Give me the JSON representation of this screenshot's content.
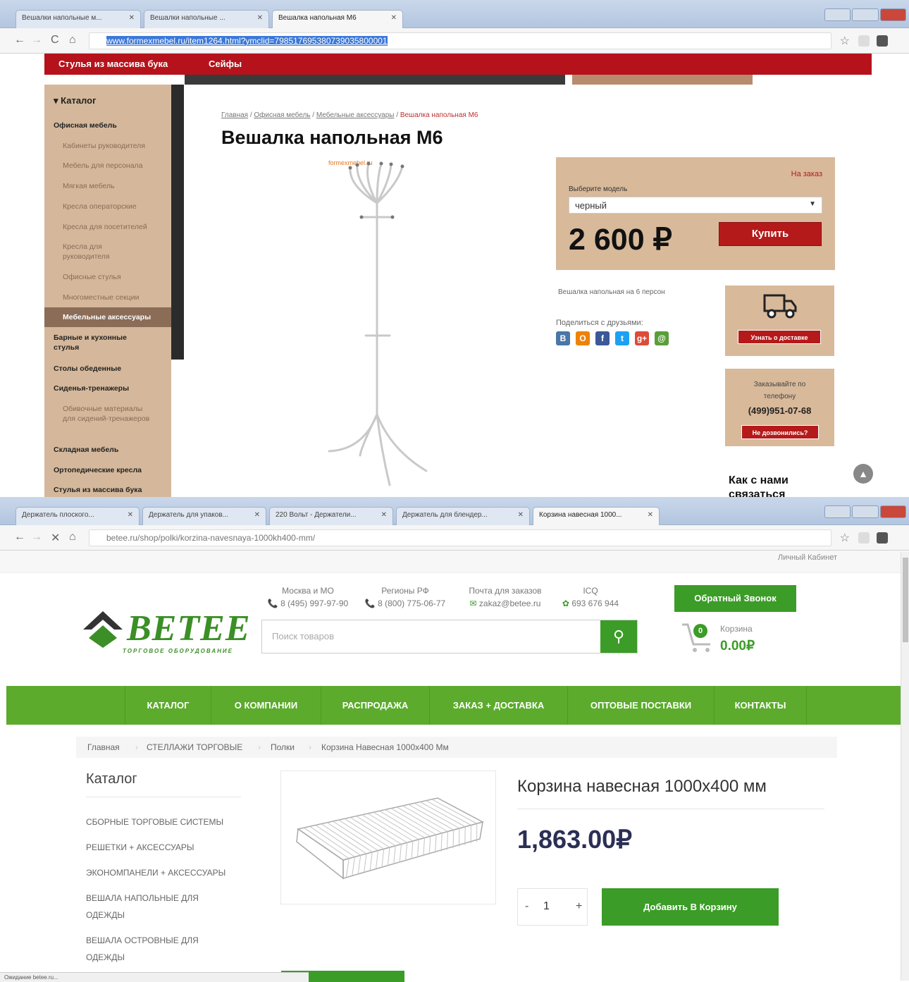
{
  "window1": {
    "tabs": [
      {
        "label": "Вешалки напольные м..."
      },
      {
        "label": "Вешалки напольные ..."
      },
      {
        "label": "Вешалка напольная М6"
      }
    ],
    "url": "www.formexmebel.ru/item1264.html?ymclid=798517695380739035800001",
    "site": {
      "top_menu": [
        "Стулья из массива бука",
        "Сейфы"
      ],
      "catalog_title": "▾ Каталог",
      "sidebar": [
        {
          "label": "Офисная мебель",
          "kind": "top"
        },
        {
          "label": "Кабинеты руководителя",
          "kind": "sub"
        },
        {
          "label": "Мебель для персонала",
          "kind": "sub"
        },
        {
          "label": "Мягкая мебель",
          "kind": "sub"
        },
        {
          "label": "Кресла операторские",
          "kind": "sub"
        },
        {
          "label": "Кресла для посетителей",
          "kind": "sub"
        },
        {
          "label": "Кресла для руководителя",
          "kind": "sub"
        },
        {
          "label": "Офисные стулья",
          "kind": "sub"
        },
        {
          "label": "Многоместные секции",
          "kind": "sub"
        },
        {
          "label": "Мебельные аксессуары",
          "kind": "active"
        },
        {
          "label": "Барные и кухонные стулья",
          "kind": "top"
        },
        {
          "label": "Столы обеденные",
          "kind": "top"
        },
        {
          "label": "Сиденья-тренажеры",
          "kind": "top"
        },
        {
          "label": "Обивочные материалы для сидений-тренажеров",
          "kind": "sub"
        },
        {
          "label": "Складная мебель",
          "kind": "top"
        },
        {
          "label": "Ортопедические кресла",
          "kind": "top"
        },
        {
          "label": "Стулья из массива бука",
          "kind": "top"
        }
      ],
      "breadcrumb": {
        "home": "Главная",
        "c1": "Офисная мебель",
        "c2": "Мебельные аксессуары",
        "current": "Вешалка напольная М6"
      },
      "title": "Вешалка напольная М6",
      "image_brand": "formexmebel.ru",
      "availability": "На заказ",
      "model_label": "Выберите модель",
      "model_value": "черный",
      "price": "2 600 ₽",
      "buy_label": "Купить",
      "description": "Вешалка напольная на 6 персон",
      "share_label": "Поделиться с друзьями:",
      "social": [
        {
          "glyph": "В",
          "color": "#4a76a8"
        },
        {
          "glyph": "О",
          "color": "#ee8208"
        },
        {
          "glyph": "f",
          "color": "#3b5998"
        },
        {
          "glyph": "t",
          "color": "#1da1f2"
        },
        {
          "glyph": "g+",
          "color": "#dd4b39"
        },
        {
          "glyph": "@",
          "color": "#5a9e3a"
        }
      ],
      "delivery_btn": "Узнать о доставке",
      "phone_text": "Заказывайте по телефону",
      "phone": "(499)951-07-68",
      "callback": "Не дозвонились?",
      "contact_title": "Как с нами связаться"
    }
  },
  "window2": {
    "tabs": [
      {
        "label": "Держатель плоского..."
      },
      {
        "label": "Держатель для упаков..."
      },
      {
        "label": "220 Вольт - Держатели..."
      },
      {
        "label": "Держатель для блендер..."
      },
      {
        "label": "Корзина навесная 1000..."
      }
    ],
    "url": "betee.ru/shop/polki/korzina-navesnaya-1000kh400-mm/",
    "site": {
      "account": "Личный Кабинет",
      "logo": "BETEE",
      "logo_sub": "ТОРГОВОЕ ОБОРУДОВАНИЕ",
      "contacts": [
        {
          "label": "Москва и МО",
          "value": "8 (495) 997-97-90",
          "icon": "phone-icon"
        },
        {
          "label": "Регионы РФ",
          "value": "8 (800) 775-06-77",
          "icon": "phone-icon"
        },
        {
          "label": "Почта для заказов",
          "value": "zakaz@betee.ru",
          "icon": "mail-icon"
        },
        {
          "label": "ICQ",
          "value": "693 676 944",
          "icon": "icq-icon"
        }
      ],
      "search_placeholder": "Поиск товаров",
      "callback_btn": "Обратный Звонок",
      "cart_count": "0",
      "cart_label": "Корзина",
      "cart_total": "0.00₽",
      "nav": [
        "КАТАЛОГ",
        "О КОМПАНИИ",
        "РАСПРОДАЖА",
        "ЗАКАЗ + ДОСТАВКА",
        "ОПТОВЫЕ ПОСТАВКИ",
        "КОНТАКТЫ"
      ],
      "breadcrumb": [
        "Главная",
        "СТЕЛЛАЖИ ТОРГОВЫЕ",
        "Полки",
        "Корзина Навесная 1000х400 Мм"
      ],
      "catalog_title": "Каталог",
      "catalog": [
        "СБОРНЫЕ ТОРГОВЫЕ СИСТЕМЫ",
        "РЕШЕТКИ + АКСЕССУАРЫ",
        "ЭКОНОМПАНЕЛИ + АКСЕССУАРЫ",
        "ВЕШАЛА НАПОЛЬНЫЕ ДЛЯ ОДЕЖДЫ",
        "ВЕШАЛА ОСТРОВНЫЕ ДЛЯ ОДЕЖДЫ"
      ],
      "product_title": "Корзина навесная 1000х400 мм",
      "price": "1,863.00₽",
      "qty_minus": "-",
      "qty": "1",
      "qty_plus": "+",
      "add_to_cart": "Добавить В Корзину",
      "status": "Ожидание betee.ru..."
    }
  }
}
